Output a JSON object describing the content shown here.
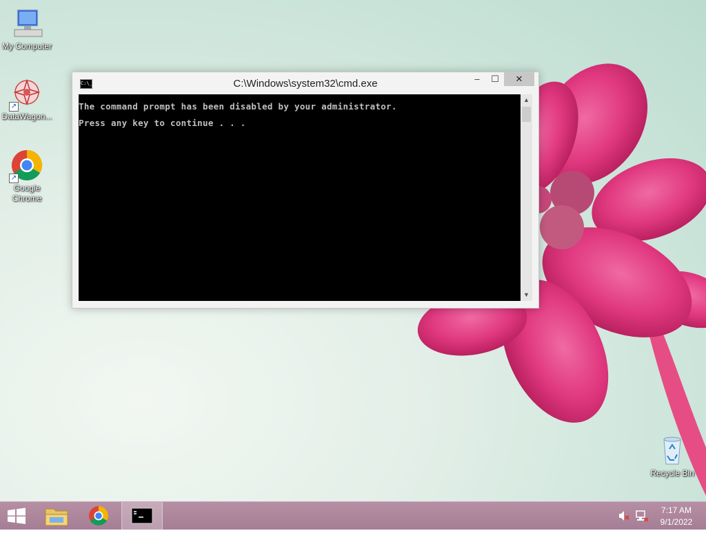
{
  "desktop": {
    "icons": [
      {
        "label": "My Computer"
      },
      {
        "label": "DataWagon..."
      },
      {
        "label": "Google Chrome"
      },
      {
        "label": "Recycle Bin"
      }
    ]
  },
  "cmd_window": {
    "title": "C:\\Windows\\system32\\cmd.exe",
    "icon_text": "C:\\_",
    "console_lines": [
      "The command prompt has been disabled by your administrator.",
      "Press any key to continue . . ."
    ],
    "buttons": {
      "minimize": "–",
      "maximize": "☐",
      "close": "✕"
    }
  },
  "taskbar": {
    "pinned": [
      "start",
      "file-explorer",
      "google-chrome",
      "command-prompt"
    ],
    "tray": {
      "sound": "muted",
      "network": "disconnected"
    },
    "clock": {
      "time": "7:17 AM",
      "date": "9/1/2022"
    }
  },
  "colors": {
    "taskbar": "#a98299",
    "console_bg": "#000000",
    "console_text": "#c0c0c0",
    "flower": "#e0387f"
  }
}
